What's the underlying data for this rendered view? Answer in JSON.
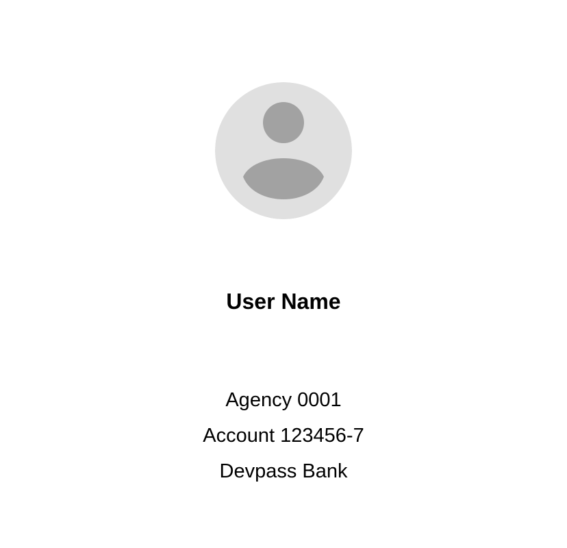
{
  "profile": {
    "avatar": {
      "icon": "person-placeholder-icon",
      "background_color": "#e0e0e0",
      "figure_color": "#a2a2a2"
    },
    "user_name": "User Name",
    "agency": "Agency 0001",
    "account": "Account 123456-7",
    "bank": "Devpass Bank"
  }
}
